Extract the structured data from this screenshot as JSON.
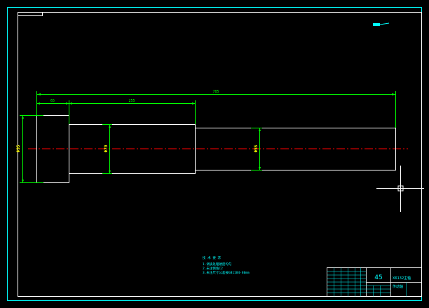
{
  "colors": {
    "background": "#000000",
    "border": "#00ffff",
    "outline": "#ffffff",
    "dimension": "#00ff00",
    "diameter_text": "#ffff00",
    "centerline": "#ff0000",
    "notes": "#00ffff"
  },
  "dimensions": {
    "overall_length": "785",
    "seg1_length": "65",
    "seg2_length": "255"
  },
  "diameters": {
    "d1": "Φ95",
    "d2": "Φ70",
    "d3": "Φ55"
  },
  "notes": {
    "heading": "技 术 要 求",
    "line1": "1.调质处理硬度均匀",
    "line2": "2.未注倒角C2",
    "line3": "3.未注尺寸公差按GB1184-80mm"
  },
  "title_block": {
    "material": "45",
    "name": "X6132主轴",
    "name2": "传动轴"
  },
  "icons": {
    "crosshair": "cad-cursor-crosshair-icon",
    "ucs": "ucs-indicator-icon"
  }
}
